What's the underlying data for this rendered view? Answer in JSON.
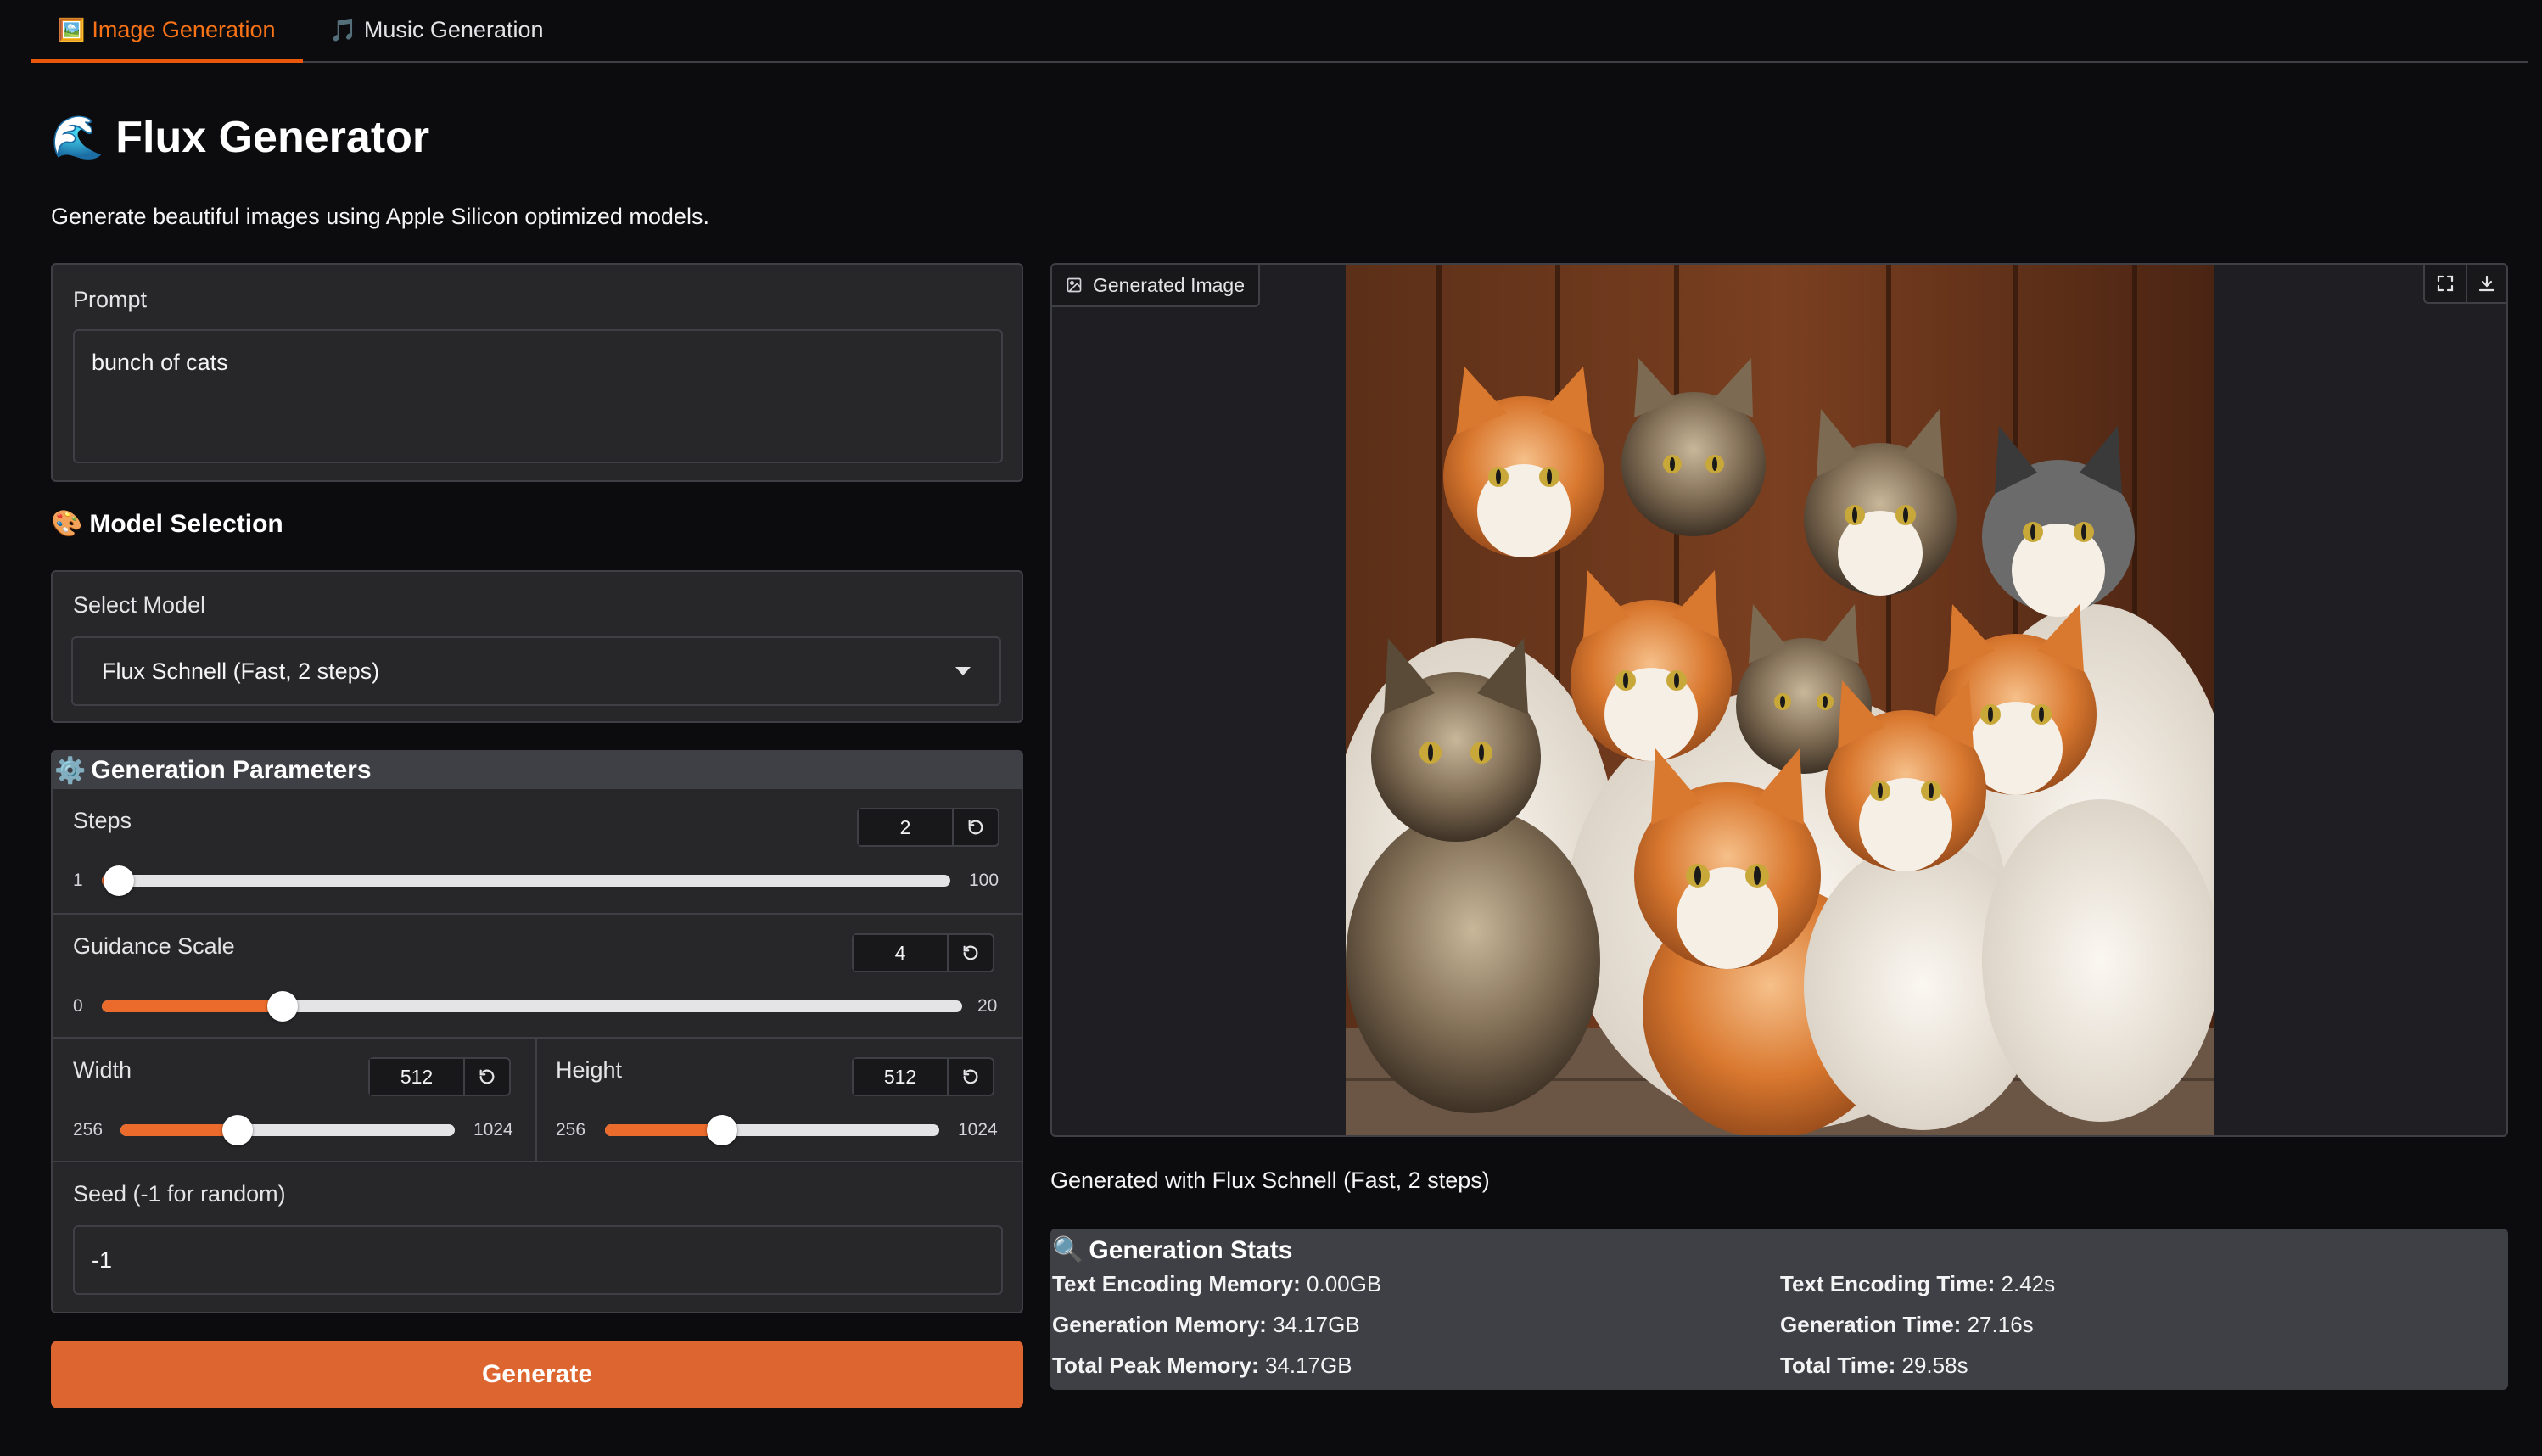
{
  "tabs": [
    {
      "icon": "🖼️",
      "label": "Image Generation",
      "active": true
    },
    {
      "icon": "🎵",
      "label": "Music Generation",
      "active": false
    }
  ],
  "header": {
    "icon": "🌊",
    "title": "Flux Generator",
    "subtitle": "Generate beautiful images using Apple Silicon optimized models."
  },
  "prompt": {
    "label": "Prompt",
    "value": "bunch of cats"
  },
  "model_selection": {
    "icon": "🎨",
    "heading": "Model Selection",
    "label": "Select Model",
    "selected": "Flux Schnell (Fast, 2 steps)"
  },
  "generation_parameters": {
    "icon": "⚙️",
    "heading": "Generation Parameters",
    "steps": {
      "label": "Steps",
      "value": "2",
      "min": "1",
      "max": "100"
    },
    "guidance": {
      "label": "Guidance Scale",
      "value": "4",
      "min": "0",
      "max": "20"
    },
    "width": {
      "label": "Width",
      "value": "512",
      "min": "256",
      "max": "1024"
    },
    "height": {
      "label": "Height",
      "value": "512",
      "min": "256",
      "max": "1024"
    },
    "seed": {
      "label": "Seed (-1 for random)",
      "value": "-1"
    }
  },
  "generate_button": "Generate",
  "output": {
    "image_label": "Generated Image",
    "caption": "Generated with Flux Schnell (Fast, 2 steps)"
  },
  "stats": {
    "icon": "🔍",
    "heading": "Generation Stats",
    "items": [
      {
        "key": "Text Encoding Memory:",
        "value": "0.00GB"
      },
      {
        "key": "Generation Memory:",
        "value": "34.17GB"
      },
      {
        "key": "Total Peak Memory:",
        "value": "34.17GB"
      },
      {
        "key": "Text Encoding Time:",
        "value": "2.42s"
      },
      {
        "key": "Generation Time:",
        "value": "27.16s"
      },
      {
        "key": "Total Time:",
        "value": "29.58s"
      }
    ]
  },
  "colors": {
    "accent": "#ea580c",
    "button": "#dd6530",
    "background": "#0c0c0f",
    "panel": "#27272a"
  }
}
